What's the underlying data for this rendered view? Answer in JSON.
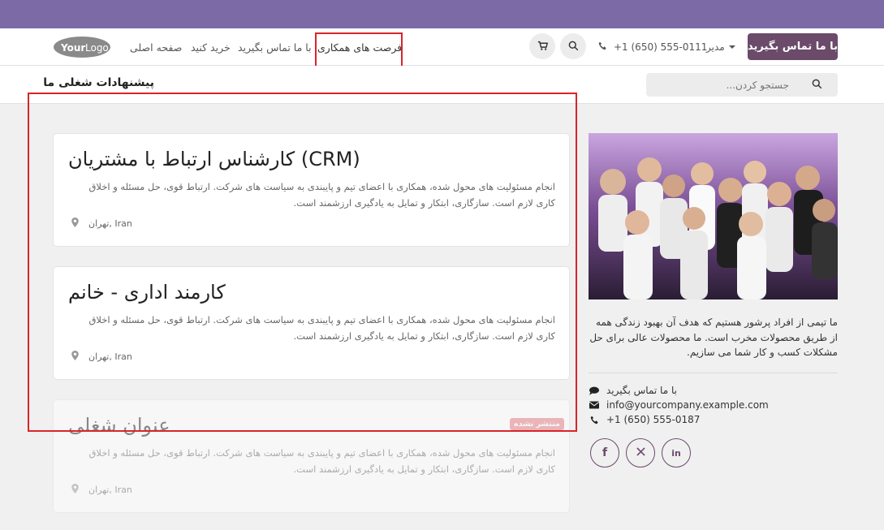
{
  "navbar": {
    "logo_text": "YourLogo",
    "links": [
      "صفحه اصلی",
      "خرید کنید",
      "با ما تماس بگیرید",
      "فرصت های همکاری"
    ],
    "phone": "+1 (650) 555-0111",
    "admin_label": "مدیر",
    "contact_button": "با ما تماس بگیرید",
    "icons": [
      "cart-icon",
      "search-icon",
      "phone-icon"
    ]
  },
  "subheader": {
    "title": "پیشنهادات شغلی ما",
    "search_placeholder": "جستجو کردن..."
  },
  "jobs": [
    {
      "title": "کارشناس ارتباط با مشتریان (CRM)",
      "description": "انجام مسئولیت های محول شده، همکاری با اعضای تیم و پایبندی به سیاست های شرکت. ارتباط قوی، حل مسئله و اخلاق کاری لازم است. سازگاری، ابتکار و تمایل به یادگیری ارزشمند است.",
      "location": "تهران, Iran",
      "published": true
    },
    {
      "title": "کارمند اداری - خانم",
      "description": "انجام مسئولیت های محول شده، همکاری با اعضای تیم و پایبندی به سیاست های شرکت. ارتباط قوی، حل مسئله و اخلاق کاری لازم است. سازگاری، ابتکار و تمایل به یادگیری ارزشمند است.",
      "location": "تهران, Iran",
      "published": true
    },
    {
      "title": "عنوان شغلی",
      "description": "انجام مسئولیت های محول شده، همکاری با اعضای تیم و پایبندی به سیاست های شرکت. ارتباط قوی، حل مسئله و اخلاق کاری لازم است. سازگاری، ابتکار و تمایل به یادگیری ارزشمند است.",
      "location": "تهران, Iran",
      "published": false,
      "badge": "منتشر نشده"
    }
  ],
  "sidebar": {
    "about": "ما تیمی از افراد پرشور هستیم که هدف آن بهبود زندگی همه از طریق محصولات مخرب است. ما محصولات عالی برای حل مشکلات کسب و کار شما می سازیم.",
    "contact_label": "با ما تماس بگیرید",
    "email": "info@yourcompany.example.com",
    "phone": "+1 (650) 555-0187",
    "social": [
      "facebook-icon",
      "x-icon",
      "linkedin-icon"
    ]
  },
  "colors": {
    "topbar": "#7c6aa6",
    "primary_button": "#6b4a6a",
    "badge": "#e57b84",
    "highlight": "#d9252b"
  }
}
